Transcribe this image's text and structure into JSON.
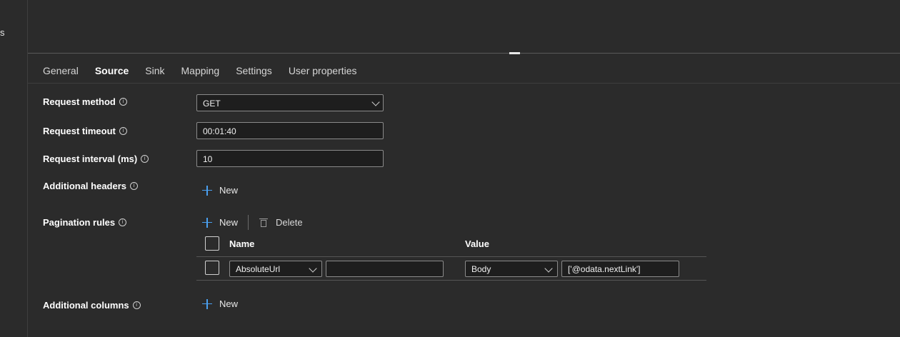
{
  "left_rail": {
    "stub_text": "s"
  },
  "tabs": [
    {
      "label": "General",
      "active": false
    },
    {
      "label": "Source",
      "active": true
    },
    {
      "label": "Sink",
      "active": false
    },
    {
      "label": "Mapping",
      "active": false
    },
    {
      "label": "Settings",
      "active": false
    },
    {
      "label": "User properties",
      "active": false
    }
  ],
  "form": {
    "request_method": {
      "label": "Request method",
      "value": "GET"
    },
    "request_timeout": {
      "label": "Request timeout",
      "value": "00:01:40"
    },
    "request_interval": {
      "label": "Request interval (ms)",
      "value": "10"
    },
    "additional_headers": {
      "label": "Additional headers",
      "new_label": "New"
    },
    "pagination_rules": {
      "label": "Pagination rules",
      "new_label": "New",
      "delete_label": "Delete",
      "columns": {
        "name": "Name",
        "value": "Value"
      },
      "rows": [
        {
          "name_select": "AbsoluteUrl",
          "name_extra": "",
          "value_select": "Body",
          "value_text": "['@odata.nextLink']"
        }
      ]
    },
    "additional_columns": {
      "label": "Additional columns",
      "new_label": "New"
    }
  },
  "info_glyph": "i",
  "colors": {
    "accent": "#4aa0f0",
    "background": "#2b2b2b",
    "input_background": "#1e1e1e"
  }
}
